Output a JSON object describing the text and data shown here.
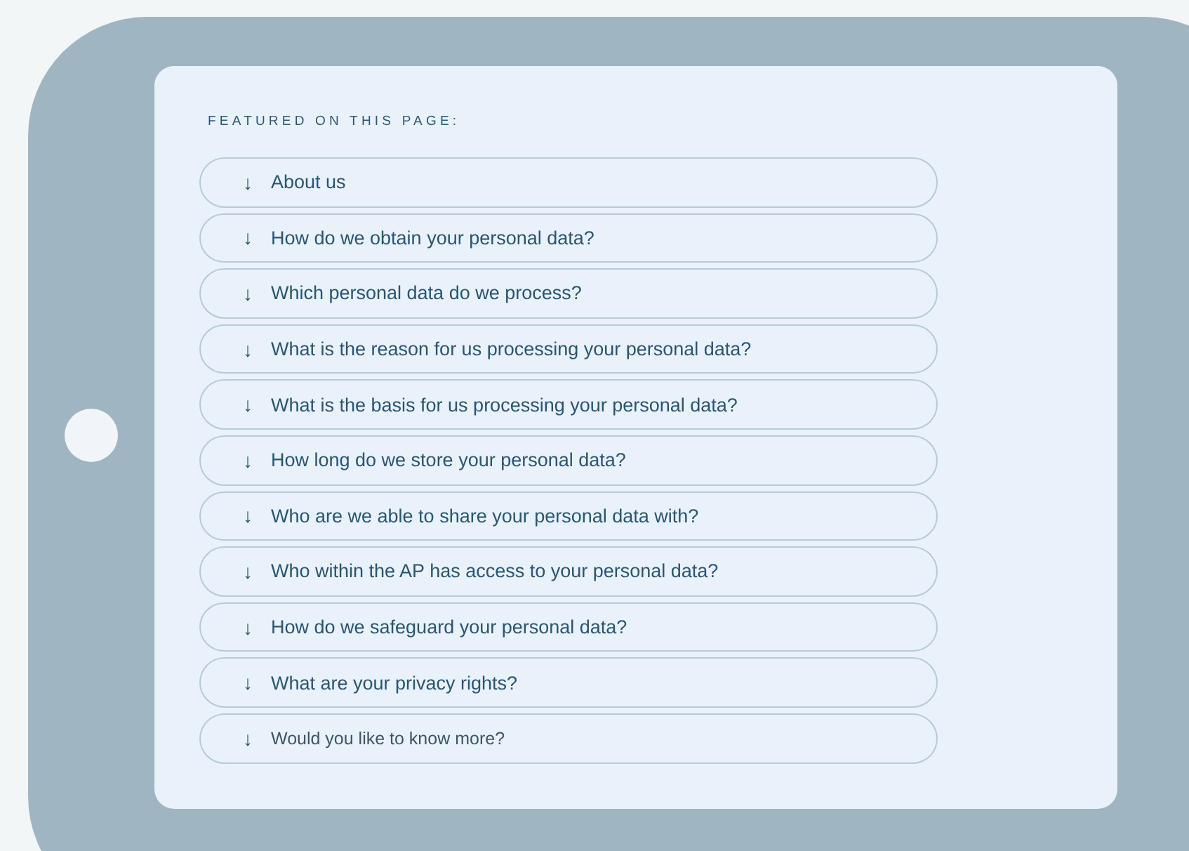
{
  "heading": "FEATURED ON THIS PAGE:",
  "links": [
    {
      "kind": "primary",
      "icon": "↓",
      "label": "About us"
    },
    {
      "kind": "primary",
      "icon": "↓",
      "label": "How do we obtain your personal data?"
    },
    {
      "kind": "primary",
      "icon": "↓",
      "label": "Which personal data do we process?"
    },
    {
      "kind": "primary",
      "icon": "↓",
      "label": "What is the reason for us processing your personal data?"
    },
    {
      "kind": "primary",
      "icon": "↓",
      "label": "What is the basis for us processing your personal data?"
    },
    {
      "kind": "primary",
      "icon": "↓",
      "label": "How long do we store your personal data?"
    },
    {
      "kind": "primary",
      "icon": "↓",
      "label": "Who are we able to share your personal data with?"
    },
    {
      "kind": "primary",
      "icon": "↓",
      "label": "Who within the AP has access to your personal data?"
    },
    {
      "kind": "primary",
      "icon": "↓",
      "label": "How do we safeguard your personal data?"
    },
    {
      "kind": "primary",
      "icon": "↓",
      "label": "What are your privacy rights?"
    },
    {
      "kind": "secondary",
      "icon": "↓",
      "label": "Would you like to know more?"
    }
  ]
}
